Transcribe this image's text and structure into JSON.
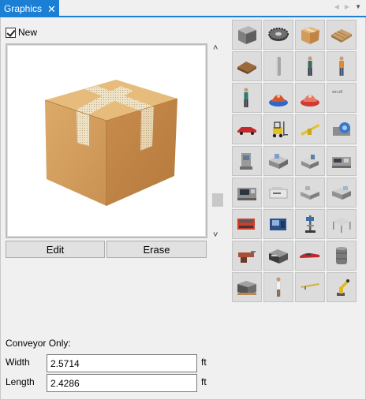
{
  "tab": {
    "title": "Graphics",
    "close_glyph": "✕"
  },
  "tab_nav": {
    "prev": "◀",
    "next": "▶",
    "menu": "▼"
  },
  "new_checkbox": {
    "label": "New",
    "checked": true
  },
  "preview": {
    "icon": "cardboard-box"
  },
  "scrollbar": {
    "up": "˄",
    "down": "˅"
  },
  "buttons": {
    "edit": "Edit",
    "erase": "Erase"
  },
  "palette": {
    "items": [
      "steel-box-icon",
      "gear-icon",
      "cardboard-box-icon",
      "pallet-icon",
      "wood-pallet-icon",
      "cylinder-icon",
      "worker-icon",
      "worker-orange-icon",
      "worker-green-icon",
      "machine-dome-blue-icon",
      "machine-dome-red-icon",
      "small-label-icon",
      "red-car-icon",
      "forklift-icon",
      "crane-icon",
      "drum-machine-icon",
      "machine-tool-icon",
      "press-machine-icon",
      "workstation-icon",
      "lathe-icon",
      "cnc-machine-icon",
      "printer-machine-icon",
      "grinder-icon",
      "bench-machine-icon",
      "red-conveyor-icon",
      "blue-machine-icon",
      "drill-press-icon",
      "table-icon",
      "vise-icon",
      "tool-cabinet-icon",
      "red-sportscar-icon",
      "barrel-icon",
      "crate-stack-icon",
      "person-white-icon",
      "beam-icon",
      "robot-arm-icon"
    ],
    "small_label_text": "sm.z5"
  },
  "conveyor": {
    "heading": "Conveyor Only:",
    "width_label": "Width",
    "width_value": "2.5714",
    "length_label": "Length",
    "length_value": "2.4286",
    "unit": "ft"
  },
  "colors": {
    "accent": "#1c7fd6",
    "panel": "#f0f0f0",
    "box_front": "#d7a05e",
    "box_side": "#c28447",
    "box_top": "#e8bd7e",
    "tape": "#efe4c8"
  }
}
